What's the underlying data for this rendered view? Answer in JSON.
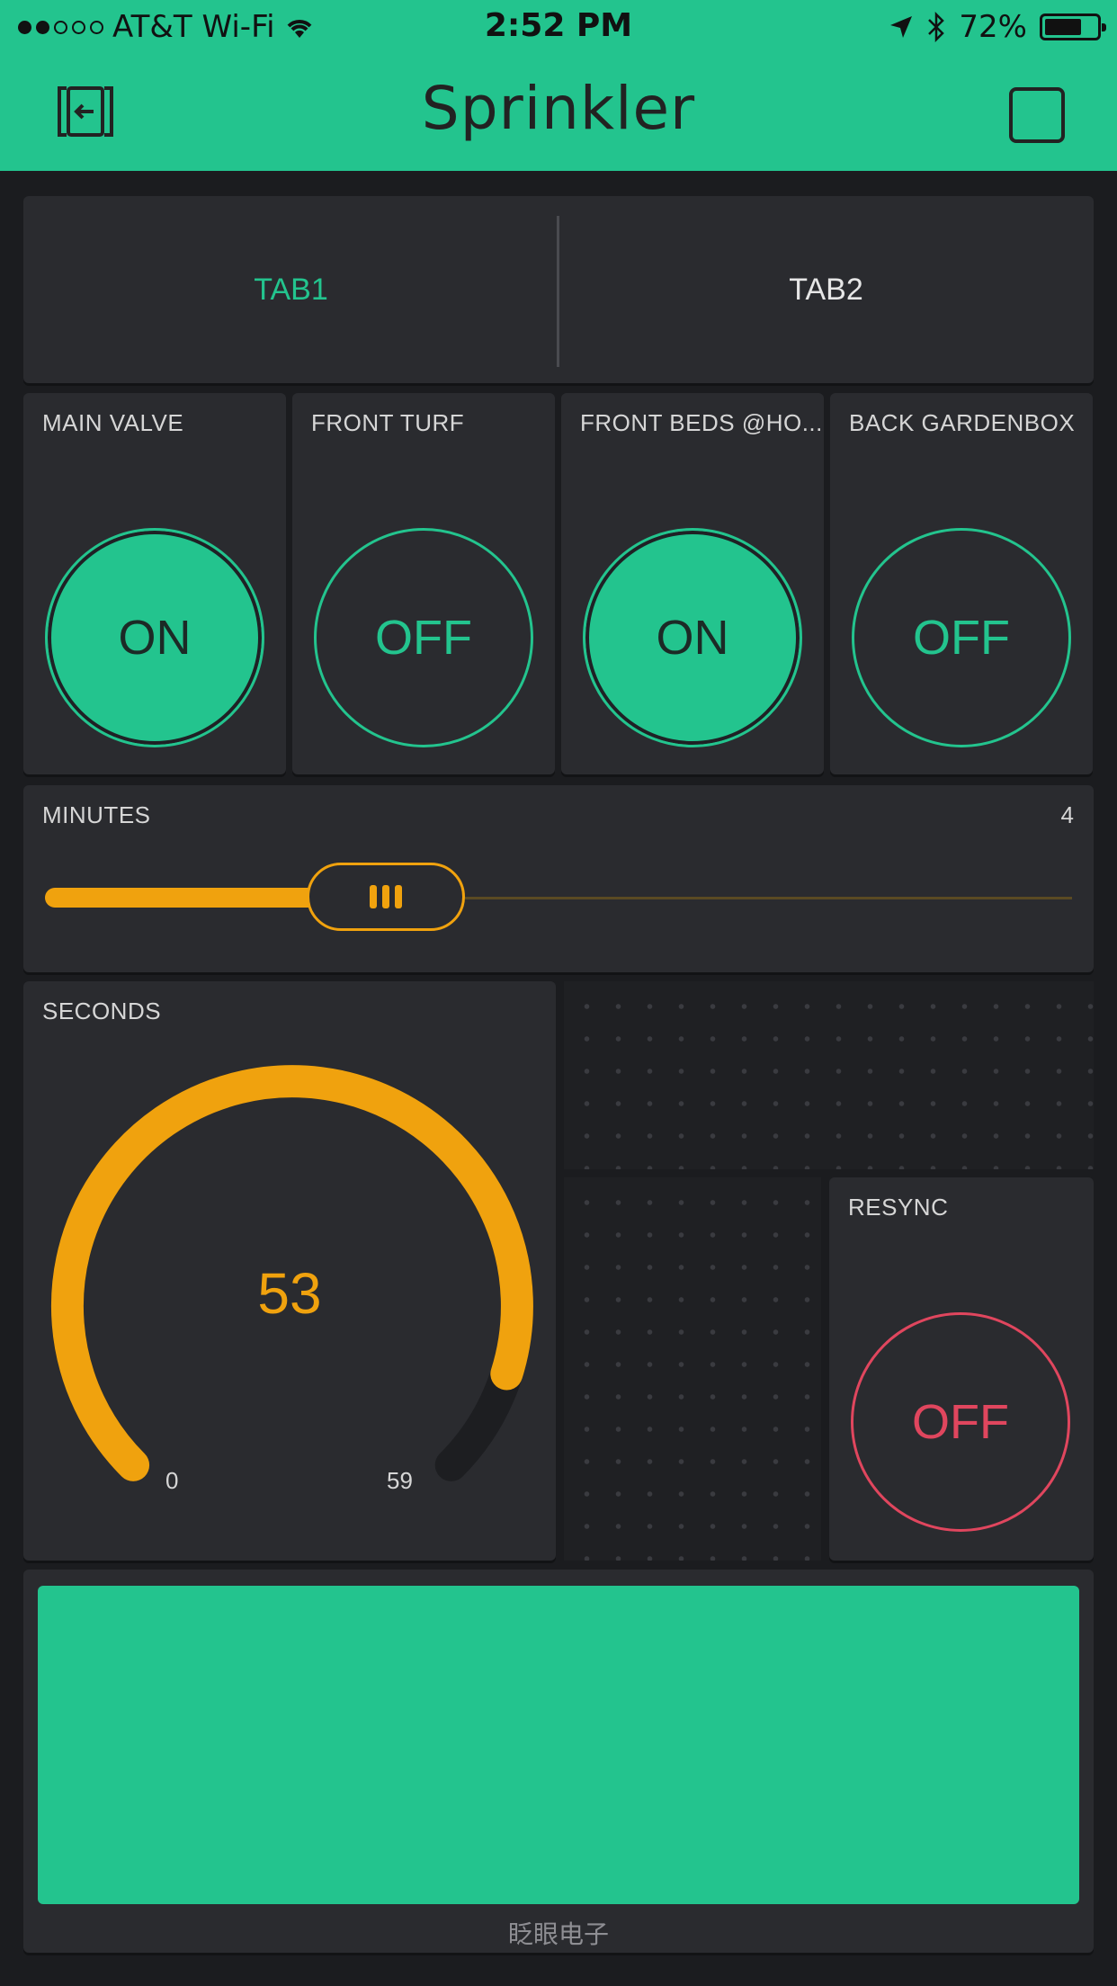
{
  "status_bar": {
    "carrier": "AT&T Wi-Fi",
    "time": "2:52 PM",
    "battery_text": "72%",
    "battery_level": 0.72,
    "signal_dots_filled": 2,
    "signal_dots_total": 5
  },
  "header": {
    "title": "Sprinkler"
  },
  "tabs": [
    {
      "label": "TAB1",
      "active": true
    },
    {
      "label": "TAB2",
      "active": false
    }
  ],
  "buttons": [
    {
      "label": "MAIN VALVE",
      "state": "ON"
    },
    {
      "label": "FRONT TURF",
      "state": "OFF"
    },
    {
      "label": "FRONT BEDS @HO...",
      "state": "ON"
    },
    {
      "label": "BACK GARDENBOX",
      "state": "OFF"
    }
  ],
  "slider": {
    "label": "MINUTES",
    "value": "4"
  },
  "gauge": {
    "label": "SECONDS",
    "value": "53",
    "min": "0",
    "max": "59"
  },
  "resync": {
    "label": "RESYNC",
    "state": "OFF"
  },
  "terminal": {
    "caption": "眨眼电子"
  },
  "colors": {
    "accent_green": "#23c48e",
    "accent_orange": "#f0a20e",
    "accent_red": "#e0465e",
    "background": "#1b1c1f",
    "widget": "#2a2b2f"
  }
}
